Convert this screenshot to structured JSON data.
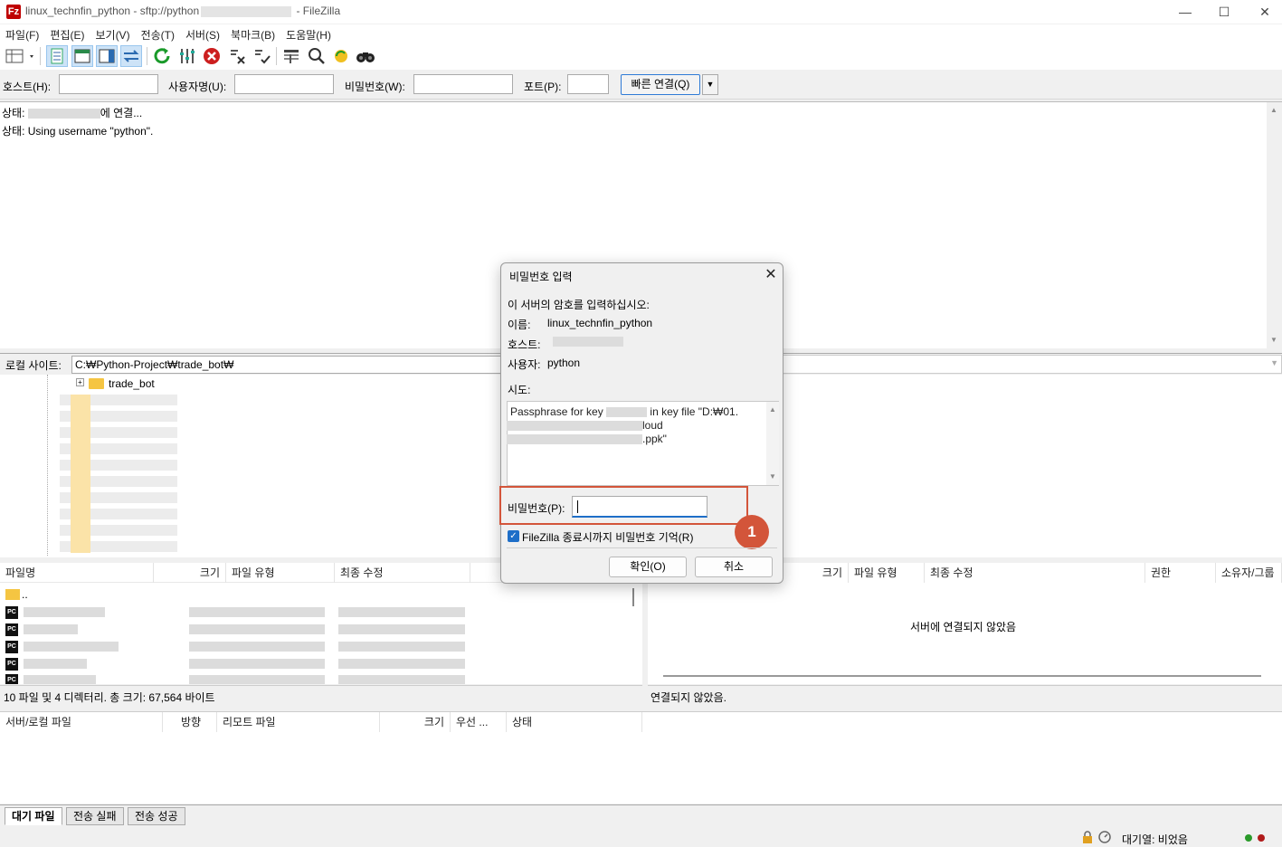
{
  "window": {
    "title_prefix": "linux_technfin_python - sftp://python",
    "title_suffix": "- FileZilla",
    "app_icon_letter": "Fz"
  },
  "menu": [
    "파일(F)",
    "편집(E)",
    "보기(V)",
    "전송(T)",
    "서버(S)",
    "북마크(B)",
    "도움말(H)"
  ],
  "quickconnect": {
    "host_label": "호스트(H):",
    "user_label": "사용자명(U):",
    "pass_label": "비밀번호(W):",
    "port_label": "포트(P):",
    "connect_label": "빠른 연결(Q)"
  },
  "log": {
    "line1_prefix": "상태:",
    "line1_suffix": "에 연결...",
    "line2": "상태: Using username \"python\"."
  },
  "local": {
    "site_label": "로컬 사이트:",
    "path": "C:₩Python-Project₩trade_bot₩",
    "tree_folder": "trade_bot",
    "headers": [
      "파일명",
      "크기",
      "파일 유형",
      "최종 수정"
    ],
    "parent_dir": "..",
    "status": "10 파일 및 4 디렉터리. 총 크기: 67,564 바이트"
  },
  "remote": {
    "headers": [
      "크기",
      "파일 유형",
      "최종 수정",
      "권한",
      "소유자/그룹"
    ],
    "empty_message": "서버에 연결되지 않았음",
    "status": "연결되지 않았음."
  },
  "queue": {
    "headers": [
      "서버/로컬 파일",
      "방향",
      "리모트 파일",
      "크기",
      "우선 ...",
      "상태"
    ],
    "tabs": [
      "대기 파일",
      "전송 실패",
      "전송 성공"
    ],
    "queue_status": "대기열: 비었음"
  },
  "dialog": {
    "title": "비밀번호 입력",
    "prompt": "이 서버의 암호를 입력하십시오:",
    "name_label": "이름:",
    "name_value": "linux_technfin_python",
    "host_label": "호스트:",
    "user_label": "사용자:",
    "user_value": "python",
    "challenge_label": "시도:",
    "challenge_line1a": "Passphrase for key",
    "challenge_line1b": "in key file \"D:₩01.",
    "challenge_line2": "loud",
    "challenge_line3": ".ppk\"",
    "password_label": "비밀번호(P):",
    "password_value": "",
    "remember_label": "FileZilla 종료시까지 비밀번호 기억(R)",
    "remember_checked": true,
    "ok_label": "확인(O)",
    "cancel_label": "취소",
    "annotation_number": "1"
  }
}
